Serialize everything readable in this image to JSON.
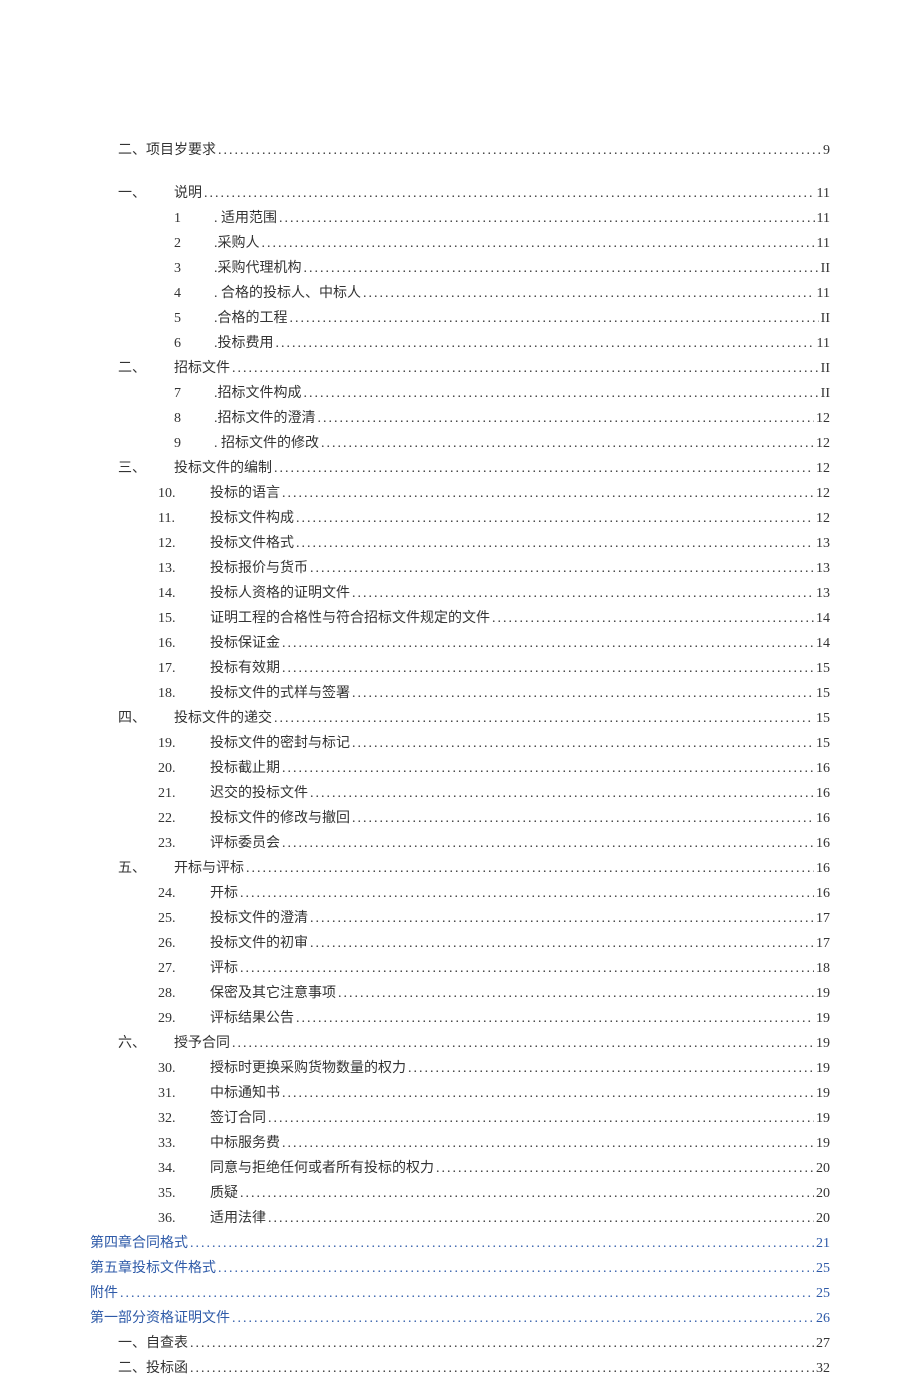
{
  "entries": [
    {
      "indent": "indent-1",
      "title": "二、项目岁要求",
      "page": "9",
      "link": false
    },
    {
      "spacer": true
    },
    {
      "indent": "indent-1",
      "prefix": "一、",
      "prefixClass": "cn-num",
      "title": "说明",
      "page": "11",
      "link": false
    },
    {
      "indent": "indent-2",
      "prefix": "1",
      "prefixClass": "num-prefix",
      "title": ". 适用范围",
      "page": "11",
      "link": false
    },
    {
      "indent": "indent-2",
      "prefix": "2",
      "prefixClass": "num-prefix",
      "title": ".采购人",
      "page": "11",
      "link": false
    },
    {
      "indent": "indent-2",
      "prefix": "3",
      "prefixClass": "num-prefix",
      "title": ".采购代理机构",
      "page": "II",
      "link": false
    },
    {
      "indent": "indent-2",
      "prefix": "4",
      "prefixClass": "num-prefix",
      "title": ". 合格的投标人、中标人",
      "page": "11",
      "link": false
    },
    {
      "indent": "indent-2",
      "prefix": "5",
      "prefixClass": "num-prefix",
      "title": ".合格的工程",
      "page": "II",
      "link": false
    },
    {
      "indent": "indent-2",
      "prefix": "6",
      "prefixClass": "num-prefix",
      "title": ".投标费用",
      "page": "11",
      "link": false
    },
    {
      "indent": "indent-1",
      "prefix": "二、",
      "prefixClass": "cn-num",
      "title": "招标文件",
      "page": "II",
      "link": false
    },
    {
      "indent": "indent-2",
      "prefix": "7",
      "prefixClass": "num-prefix",
      "title": ".招标文件构成",
      "page": "II",
      "link": false
    },
    {
      "indent": "indent-2",
      "prefix": "8",
      "prefixClass": "num-prefix",
      "title": ".招标文件的澄清",
      "page": "12",
      "link": false
    },
    {
      "indent": "indent-2",
      "prefix": "9",
      "prefixClass": "num-prefix",
      "title": ". 招标文件的修改",
      "page": "12",
      "link": false
    },
    {
      "indent": "indent-1",
      "prefix": "三、",
      "prefixClass": "cn-num",
      "title": "投标文件的编制",
      "page": "12",
      "link": false
    },
    {
      "indent": "indent-2b",
      "prefix": "10.",
      "prefixClass": "num-prefix-wide",
      "title": "投标的语言",
      "page": "12",
      "link": false
    },
    {
      "indent": "indent-2b",
      "prefix": "11.",
      "prefixClass": "num-prefix-wide",
      "title": "投标文件构成",
      "page": "12",
      "link": false
    },
    {
      "indent": "indent-2b",
      "prefix": "12.",
      "prefixClass": "num-prefix-wide",
      "title": "投标文件格式",
      "page": "13",
      "link": false
    },
    {
      "indent": "indent-2b",
      "prefix": "13.",
      "prefixClass": "num-prefix-wide",
      "title": "投标报价与货币",
      "page": "13",
      "link": false
    },
    {
      "indent": "indent-2b",
      "prefix": "14.",
      "prefixClass": "num-prefix-wide",
      "title": "投标人资格的证明文件",
      "page": "13",
      "link": false
    },
    {
      "indent": "indent-2b",
      "prefix": "15.",
      "prefixClass": "num-prefix-wide",
      "title": "证明工程的合格性与符合招标文件规定的文件",
      "page": "14",
      "link": false
    },
    {
      "indent": "indent-2b",
      "prefix": "16.",
      "prefixClass": "num-prefix-wide",
      "title": "投标保证金",
      "page": "14",
      "link": false
    },
    {
      "indent": "indent-2b",
      "prefix": "17.",
      "prefixClass": "num-prefix-wide",
      "title": "投标有效期",
      "page": "15",
      "link": false
    },
    {
      "indent": "indent-2b",
      "prefix": "18.",
      "prefixClass": "num-prefix-wide",
      "title": "投标文件的式样与签署",
      "page": "15",
      "link": false
    },
    {
      "indent": "indent-1",
      "prefix": "四、",
      "prefixClass": "cn-num",
      "title": "投标文件的递交",
      "page": "15",
      "link": false
    },
    {
      "indent": "indent-2b",
      "prefix": "19.",
      "prefixClass": "num-prefix-wide",
      "title": "投标文件的密封与标记",
      "page": "15",
      "link": false
    },
    {
      "indent": "indent-2b",
      "prefix": "20.",
      "prefixClass": "num-prefix-wide",
      "title": "投标截止期",
      "page": "16",
      "link": false
    },
    {
      "indent": "indent-2b",
      "prefix": "21.",
      "prefixClass": "num-prefix-wide",
      "title": "迟交的投标文件",
      "page": "16",
      "link": false
    },
    {
      "indent": "indent-2b",
      "prefix": "22.",
      "prefixClass": "num-prefix-wide",
      "title": "投标文件的修改与撤回",
      "page": "16",
      "link": false
    },
    {
      "indent": "indent-2b",
      "prefix": "23.",
      "prefixClass": "num-prefix-wide",
      "title": "评标委员会",
      "page": "16",
      "link": false
    },
    {
      "indent": "indent-1",
      "prefix": "五、",
      "prefixClass": "cn-num",
      "title": "开标与评标",
      "page": "16",
      "link": false
    },
    {
      "indent": "indent-2b",
      "prefix": "24.",
      "prefixClass": "num-prefix-wide",
      "title": "开标",
      "page": "16",
      "link": false
    },
    {
      "indent": "indent-2b",
      "prefix": "25.",
      "prefixClass": "num-prefix-wide",
      "title": "投标文件的澄清",
      "page": "17",
      "link": false
    },
    {
      "indent": "indent-2b",
      "prefix": "26.",
      "prefixClass": "num-prefix-wide",
      "title": "投标文件的初审",
      "page": "17",
      "link": false
    },
    {
      "indent": "indent-2b",
      "prefix": "27.",
      "prefixClass": "num-prefix-wide",
      "title": "评标",
      "page": "18",
      "link": false
    },
    {
      "indent": "indent-2b",
      "prefix": "28.",
      "prefixClass": "num-prefix-wide",
      "title": "保密及其它注意事项",
      "page": "19",
      "link": false
    },
    {
      "indent": "indent-2b",
      "prefix": "29.",
      "prefixClass": "num-prefix-wide",
      "title": "评标结果公告",
      "page": "19",
      "link": false
    },
    {
      "indent": "indent-1",
      "prefix": "六、",
      "prefixClass": "cn-num",
      "title": "授予合同",
      "page": "19",
      "link": false
    },
    {
      "indent": "indent-2b",
      "prefix": "30.",
      "prefixClass": "num-prefix-wide",
      "title": "授标时更换采购货物数量的权力",
      "page": "19",
      "link": false
    },
    {
      "indent": "indent-2b",
      "prefix": "31.",
      "prefixClass": "num-prefix-wide",
      "title": "中标通知书",
      "page": "19",
      "link": false
    },
    {
      "indent": "indent-2b",
      "prefix": "32.",
      "prefixClass": "num-prefix-wide",
      "title": "签订合同",
      "page": "19",
      "link": false
    },
    {
      "indent": "indent-2b",
      "prefix": "33.",
      "prefixClass": "num-prefix-wide",
      "title": "中标服务费",
      "page": "19",
      "link": false
    },
    {
      "indent": "indent-2b",
      "prefix": "34.",
      "prefixClass": "num-prefix-wide",
      "title": "同意与拒绝任何或者所有投标的权力",
      "page": "20",
      "link": false
    },
    {
      "indent": "indent-2b",
      "prefix": "35.",
      "prefixClass": "num-prefix-wide",
      "title": "质疑",
      "page": "20",
      "link": false
    },
    {
      "indent": "indent-2b",
      "prefix": "36.",
      "prefixClass": "num-prefix-wide",
      "title": "适用法律",
      "page": "20",
      "link": false
    },
    {
      "indent": "indent-0",
      "title": "第四章合同格式",
      "page": "21",
      "link": true
    },
    {
      "indent": "indent-0",
      "title": "第五章投标文件格式",
      "page": "25",
      "link": true
    },
    {
      "indent": "indent-0",
      "title": "附件",
      "page": "25",
      "link": true
    },
    {
      "indent": "indent-0",
      "title": "第一部分资格证明文件",
      "page": "26",
      "link": true
    },
    {
      "indent": "indent-1",
      "title": "一、自查表",
      "page": "27",
      "link": false
    },
    {
      "indent": "indent-1",
      "title": "二、投标函",
      "page": "32",
      "link": false
    }
  ]
}
